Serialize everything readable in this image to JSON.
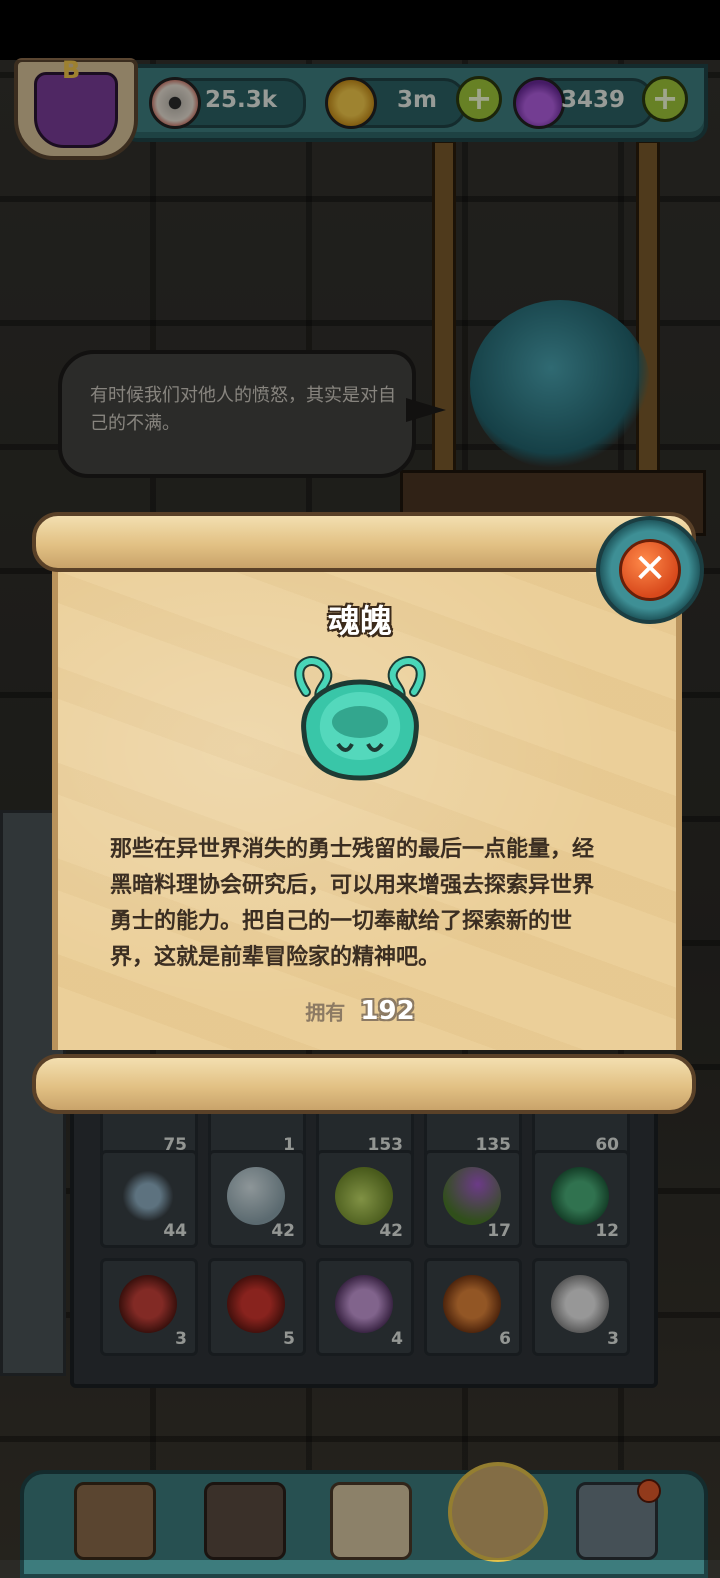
{
  "resources": {
    "eyes": {
      "value": "25.3k",
      "icon": "eyeball-icon"
    },
    "coins": {
      "value": "3m",
      "icon": "coin-icon"
    },
    "potion": {
      "value": "3439",
      "icon": "potion-icon"
    }
  },
  "npc": {
    "speech": "有时候我们对他人的愤怒，其实是对自己的不满。"
  },
  "dialog": {
    "title": "魂魄",
    "item_icon": "soul-spirit-icon",
    "description": "那些在异世界消失的勇士残留的最后一点能量，经黑暗料理协会研究后，可以用来增强去探索异世界勇士的能力。把自己的一切奉献给了探索新的世界，这就是前辈冒险家的精神吧。",
    "owned_label": "拥有",
    "owned_count": "192"
  },
  "inventory": {
    "row_top_counts": [
      "75",
      "1",
      "153",
      "135",
      "60"
    ],
    "row2": [
      "44",
      "42",
      "42",
      "17",
      "12"
    ],
    "row3": [
      "3",
      "5",
      "4",
      "6",
      "3"
    ]
  },
  "colors": {
    "accent_teal": "#3e7f80",
    "parchment": "#ebcf99",
    "close_orange": "#d8491c",
    "plus_green": "#9fc73a"
  },
  "nav": {
    "items": [
      "castle-icon",
      "monster-icon",
      "book-icon",
      "bag-icon",
      "grid-menu-icon"
    ]
  }
}
